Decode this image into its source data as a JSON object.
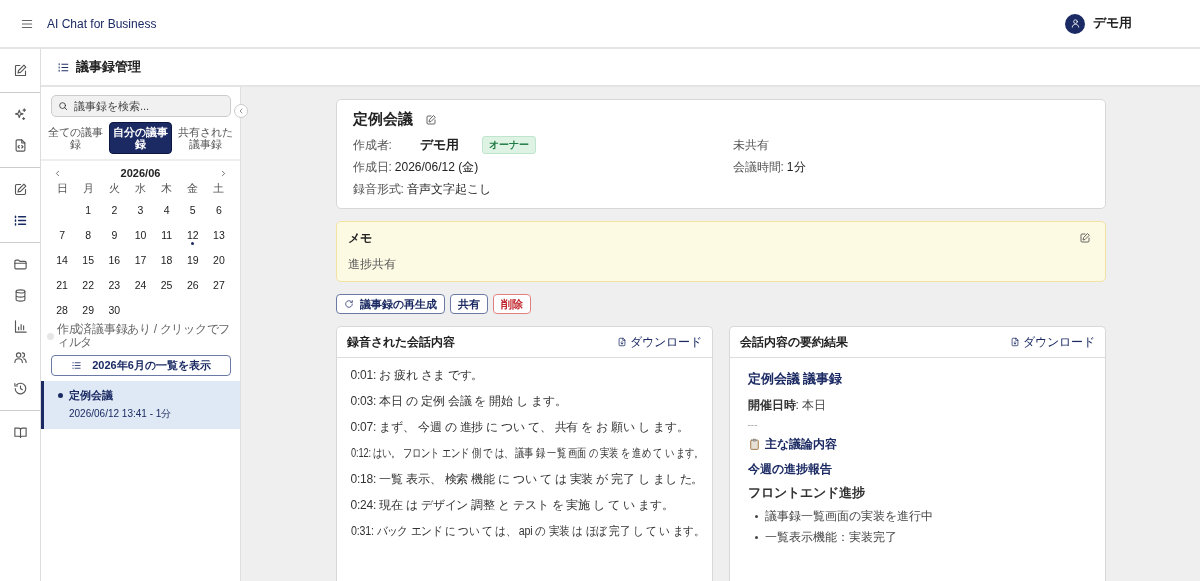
{
  "app_bar": {
    "title": "AI Chat for Business",
    "user": "デモ用"
  },
  "rail": [
    [
      {
        "kind": "compose",
        "selected": false
      }
    ],
    [
      {
        "kind": "sparkles",
        "selected": false
      },
      {
        "kind": "file-code",
        "selected": false
      }
    ],
    [
      {
        "kind": "edit",
        "selected": false
      },
      {
        "kind": "list",
        "selected": true
      }
    ],
    [
      {
        "kind": "folder",
        "selected": false
      },
      {
        "kind": "database",
        "selected": false
      },
      {
        "kind": "chart",
        "selected": false
      },
      {
        "kind": "users",
        "selected": false
      },
      {
        "kind": "history",
        "selected": false
      }
    ],
    [
      {
        "kind": "book",
        "selected": false
      }
    ]
  ],
  "page_header": {
    "title": "議事録管理"
  },
  "sidebar": {
    "search": {
      "placeholder": "議事録を検索..."
    },
    "tabs": [
      {
        "label": "全ての議事録",
        "selected": false
      },
      {
        "label": "自分の議事録",
        "selected": true
      },
      {
        "label": "共有された議事録",
        "selected": false
      }
    ],
    "calendar": {
      "month": "2026/06",
      "weekdays": [
        "日",
        "月",
        "火",
        "水",
        "木",
        "金",
        "土"
      ],
      "weeks": [
        [
          {
            "day": "1",
            "has_record": false
          },
          {
            "day": "2",
            "has_record": false
          },
          {
            "day": "3",
            "has_record": false
          },
          {
            "day": "4",
            "has_record": false
          },
          {
            "day": "5",
            "has_record": false
          },
          {
            "day": "6",
            "has_record": false
          }
        ],
        [
          {
            "day": "7",
            "has_record": false
          },
          {
            "day": "8",
            "has_record": false
          },
          {
            "day": "9",
            "has_record": false
          },
          {
            "day": "10",
            "has_record": false
          },
          {
            "day": "11",
            "has_record": false
          },
          {
            "day": "12",
            "has_record": true
          },
          {
            "day": "13",
            "has_record": false
          }
        ],
        [
          {
            "day": "14",
            "has_record": false
          },
          {
            "day": "15",
            "has_record": false
          },
          {
            "day": "16",
            "has_record": false
          },
          {
            "day": "17",
            "has_record": false
          },
          {
            "day": "18",
            "has_record": false
          },
          {
            "day": "19",
            "has_record": false
          },
          {
            "day": "20",
            "has_record": false
          }
        ],
        [
          {
            "day": "21",
            "has_record": false
          },
          {
            "day": "22",
            "has_record": false
          },
          {
            "day": "23",
            "has_record": false
          },
          {
            "day": "24",
            "has_record": false
          },
          {
            "day": "25",
            "has_record": false
          },
          {
            "day": "26",
            "has_record": false
          },
          {
            "day": "27",
            "has_record": false
          }
        ],
        [
          {
            "day": "28",
            "has_record": false
          },
          {
            "day": "29",
            "has_record": false
          },
          {
            "day": "30",
            "has_record": false
          }
        ]
      ],
      "legend": "作成済議事録あり / クリックでフィルタ"
    },
    "month_button": "2026年6月の一覧を表示",
    "items": [
      {
        "title": "定例会議",
        "meta": "2026/06/12 13:41 - 1分",
        "selected": true
      }
    ]
  },
  "detail": {
    "title": "定例会議",
    "creator_label": "作成者:",
    "creator": "デモ用",
    "role": "オーナー",
    "share_status": "未共有",
    "fields": [
      {
        "label": "作成日:",
        "value": "2026/06/12 (金)"
      },
      {
        "label": "会議時間:",
        "value": "1分"
      },
      {
        "label": "録音形式:",
        "value": "音声文字起こし"
      }
    ],
    "memo": {
      "title": "メモ",
      "text": "進捗共有"
    },
    "actions": [
      {
        "label": "議事録の再生成",
        "kind": "regenerate"
      },
      {
        "label": "共有",
        "kind": "share"
      },
      {
        "label": "削除",
        "kind": "delete"
      }
    ],
    "transcript": {
      "title": "録音された会話内容",
      "download": "ダウンロード",
      "lines": [
        "0:01: お 疲れ さま です。",
        "0:03: 本日 の 定例 会議 を 開始 し ます。",
        "0:07: まず、 今週 の 進捗 に つい て、 共有 を お 願い し ます。",
        "0:12: はい。 フロント エンド 側 で は、 議事 録 一覧 画面 の 実装 を 進め て い ます。",
        "0:18: 一覧 表示、 検索 機能 に つい て は 実装 が 完了 し まし た。",
        "0:24: 現在 は デザイン 調整 と テスト を 実施 し て い ます。",
        "0:31: バック エンド に つい て は、 api の 実装 は ほぼ 完了 し て い ます。"
      ]
    },
    "summary": {
      "title": "会話内容の要約結果",
      "download": "ダウンロード",
      "blocks": [
        {
          "kind": "h1",
          "text": "定例会議 議事録"
        },
        {
          "kind": "para",
          "text": "**開催日時**: 本日"
        },
        {
          "kind": "rule",
          "text": "---"
        },
        {
          "kind": "h2",
          "text": "主な議論内容"
        },
        {
          "kind": "h3",
          "text": "今週の進捗報告"
        },
        {
          "kind": "h4",
          "text": "フロントエンド進捗"
        },
        {
          "kind": "bullet",
          "text": "議事録一覧画面の実装を進行中"
        },
        {
          "kind": "bullet",
          "text": "一覧表示機能：実装完了"
        }
      ]
    }
  }
}
